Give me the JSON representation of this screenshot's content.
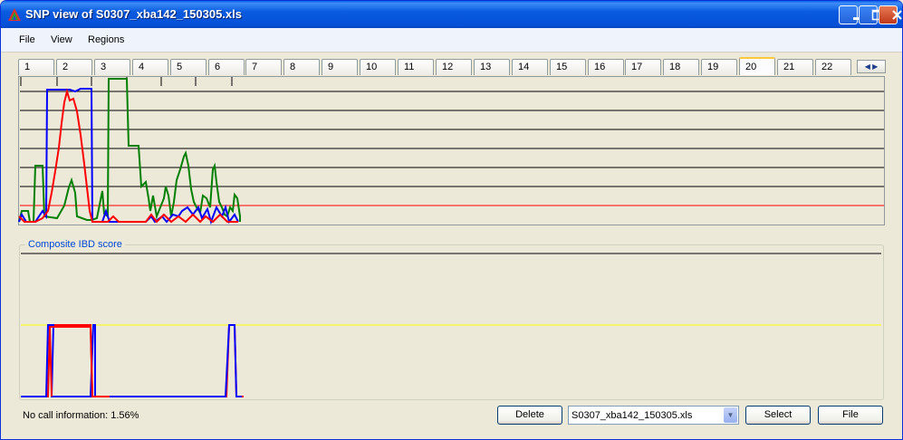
{
  "window": {
    "title": "SNP view of S0307_xba142_150305.xls"
  },
  "menu": [
    "File",
    "View",
    "Regions"
  ],
  "tabs": [
    "1",
    "2",
    "3",
    "4",
    "5",
    "6",
    "7",
    "8",
    "9",
    "10",
    "11",
    "12",
    "13",
    "14",
    "15",
    "16",
    "17",
    "18",
    "19",
    "20",
    "21",
    "22"
  ],
  "active_tab": "20",
  "group": {
    "label": "Composite IBD score"
  },
  "status": "No call information: 1.56%",
  "buttons": {
    "delete": "Delete",
    "select": "Select",
    "file": "File"
  },
  "file_combo": {
    "value": "S0307_xba142_150305.xls"
  },
  "colors": {
    "red": "#FF0000",
    "blue": "#0000FF",
    "green": "#008000",
    "yellow": "#FFFF00",
    "titlebar": "#0A5BE0"
  }
}
